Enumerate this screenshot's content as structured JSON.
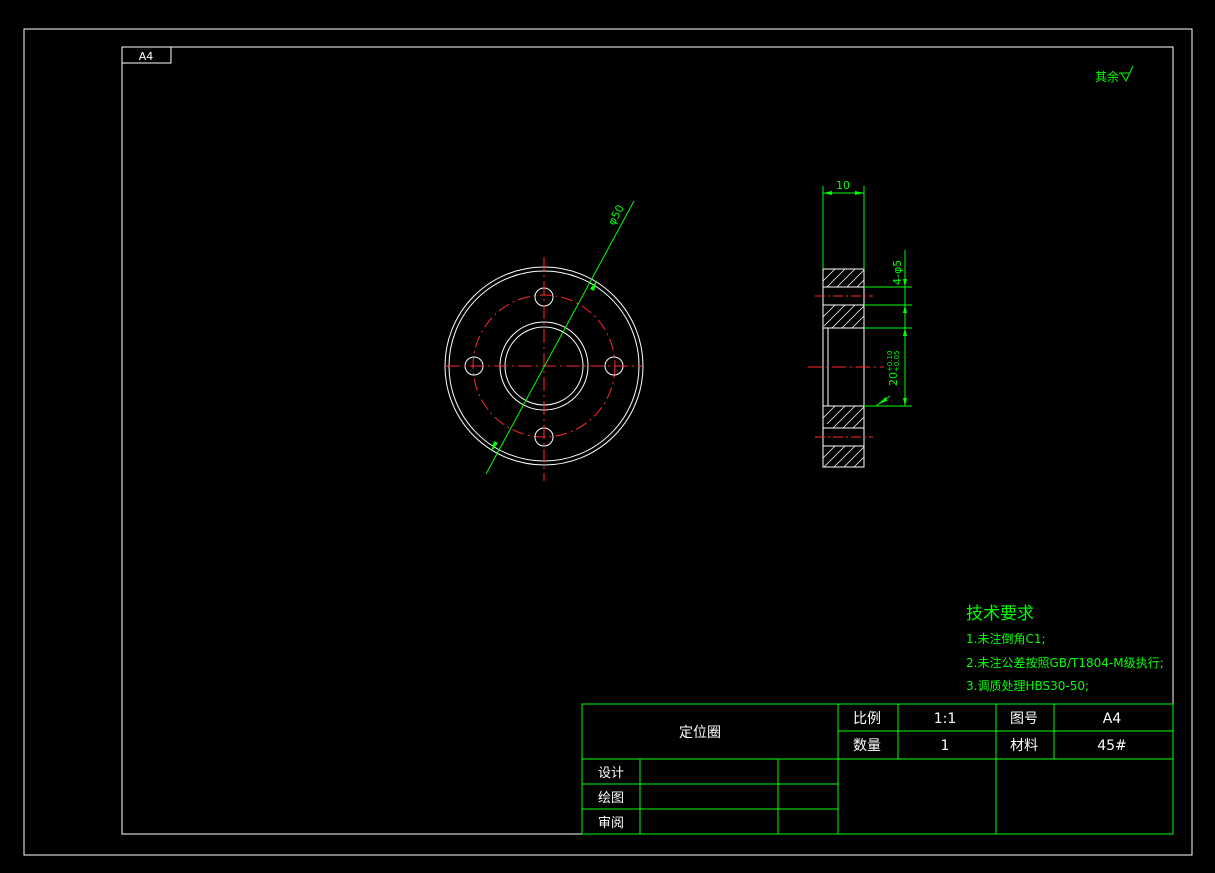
{
  "sheet": {
    "size_tag": "A4",
    "colors": {
      "background": "#000000",
      "outline": "#ffffff",
      "centerline": "#ff2a2a",
      "annotation": "#00ff00"
    }
  },
  "roughness_note": "其余",
  "front_view": {
    "diameter_label": "φ50"
  },
  "side_view": {
    "thickness_label": "10",
    "holes_label": "4-φ5",
    "bore_label": "20",
    "bore_tol_upper": "+0.10",
    "bore_tol_lower": "+0.05"
  },
  "tech_requirements": {
    "title": "技术要求",
    "items": [
      "1.未注倒角C1;",
      "2.未注公差按照GB/T1804-M级执行;",
      "3.调质处理HBS30-50;"
    ]
  },
  "title_block": {
    "part_name": "定位圈",
    "scale_label": "比例",
    "scale_value": "1:1",
    "drawing_no_label": "图号",
    "drawing_no_value": "A4",
    "qty_label": "数量",
    "qty_value": "1",
    "material_label": "材料",
    "material_value": "45#",
    "roles": [
      "设计",
      "绘图",
      "审阅"
    ]
  }
}
